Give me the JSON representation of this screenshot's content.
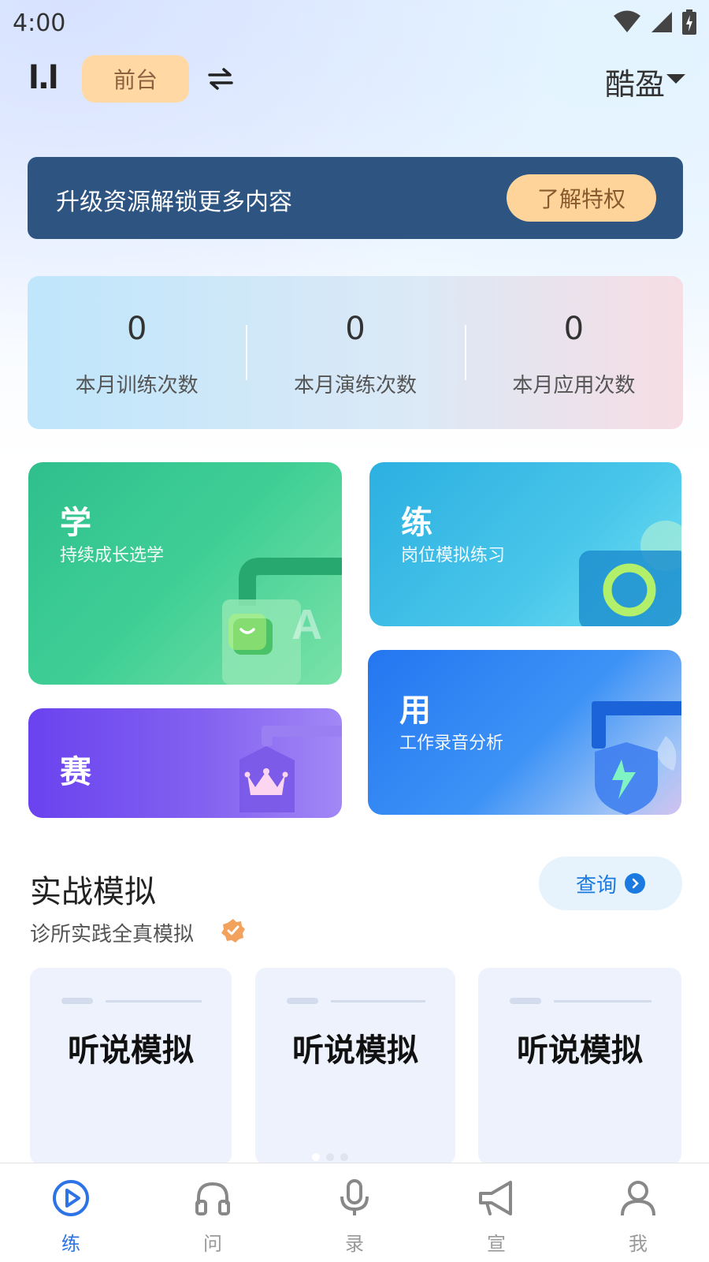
{
  "status_bar": {
    "time": "4:00"
  },
  "header": {
    "logo": "l.l",
    "role": "前台",
    "user": "酷盈"
  },
  "banner": {
    "text": "升级资源解锁更多内容",
    "button": "了解特权"
  },
  "stats": [
    {
      "value": "0",
      "label": "本月训练次数"
    },
    {
      "value": "0",
      "label": "本月演练次数"
    },
    {
      "value": "0",
      "label": "本月应用次数"
    }
  ],
  "tiles": {
    "learn": {
      "title": "学",
      "subtitle": "持续成长选学"
    },
    "practice": {
      "title": "练",
      "subtitle": "岗位模拟练习"
    },
    "compete": {
      "title": "赛"
    },
    "apply": {
      "title": "用",
      "subtitle": "工作录音分析"
    }
  },
  "section": {
    "title": "实战模拟",
    "subtitle": "诊所实践全真模拟",
    "query": "查询"
  },
  "sim_cards": [
    "听说模拟",
    "听说模拟",
    "听说模拟"
  ],
  "tabs": [
    "练",
    "问",
    "录",
    "宣",
    "我"
  ],
  "colors": {
    "accent": "#2c73e6",
    "banner": "#2e5582",
    "badge": "#ffd8a4"
  },
  "icons": [
    "wifi-icon",
    "signal-icon",
    "battery-icon",
    "switch-icon",
    "chevron-down-icon",
    "verified-icon",
    "arrow-right-icon",
    "play-icon",
    "headphones-icon",
    "mic-icon",
    "megaphone-icon",
    "user-icon"
  ]
}
